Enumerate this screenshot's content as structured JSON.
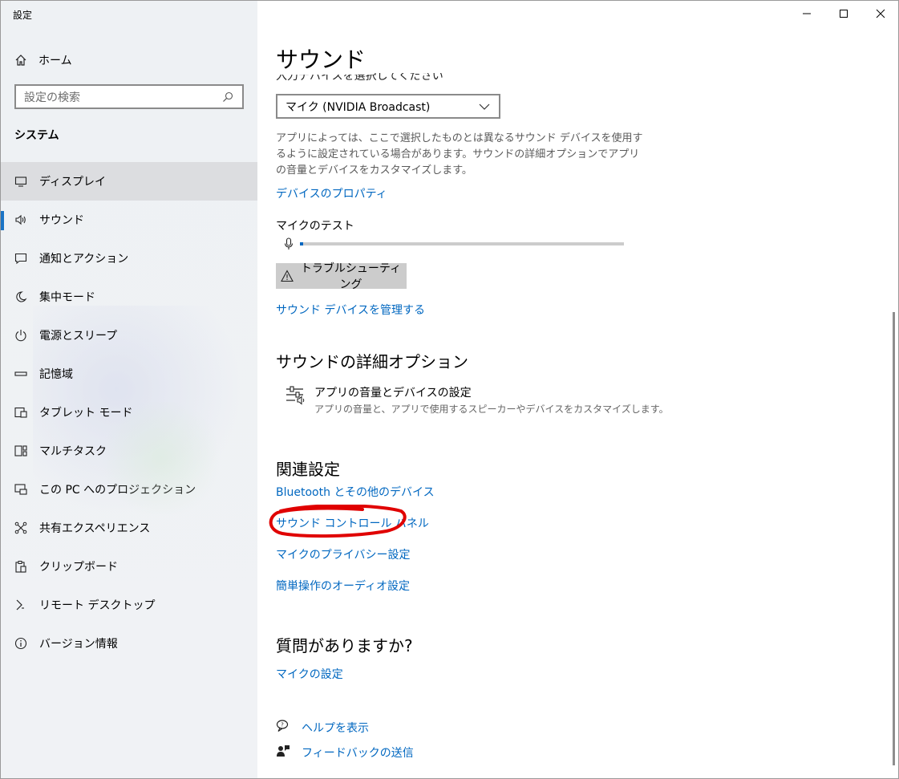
{
  "window": {
    "title": "設定",
    "controls": [
      "minimize",
      "maximize",
      "close"
    ]
  },
  "sidebar": {
    "home_label": "ホーム",
    "search_placeholder": "設定の検索",
    "section_title": "システム",
    "items": [
      {
        "label": "ディスプレイ",
        "icon": "display-icon"
      },
      {
        "label": "サウンド",
        "icon": "speaker-icon"
      },
      {
        "label": "通知とアクション",
        "icon": "notification-icon"
      },
      {
        "label": "集中モード",
        "icon": "moon-icon"
      },
      {
        "label": "電源とスリープ",
        "icon": "power-icon"
      },
      {
        "label": "記憶域",
        "icon": "storage-icon"
      },
      {
        "label": "タブレット モード",
        "icon": "tablet-icon"
      },
      {
        "label": "マルチタスク",
        "icon": "multitask-icon"
      },
      {
        "label": "この PC へのプロジェクション",
        "icon": "projection-icon"
      },
      {
        "label": "共有エクスペリエンス",
        "icon": "share-icon"
      },
      {
        "label": "クリップボード",
        "icon": "clipboard-icon"
      },
      {
        "label": "リモート デスクトップ",
        "icon": "remote-icon"
      },
      {
        "label": "バージョン情報",
        "icon": "info-icon"
      }
    ]
  },
  "main": {
    "title": "サウンド",
    "input_label_clipped": "入力デバイスを選択してください",
    "input_device": "マイク (NVIDIA Broadcast)",
    "description": "アプリによっては、ここで選択したものとは異なるサウンド デバイスを使用するように設定されている場合があります。サウンドの詳細オプションでアプリの音量とデバイスをカスタマイズします。",
    "device_properties_link": "デバイスのプロパティ",
    "mic_test_label": "マイクのテスト",
    "mic_level": 0.01,
    "troubleshoot_button": "トラブルシューティング",
    "manage_devices_link": "サウンド デバイスを管理する",
    "advanced_heading": "サウンドの詳細オプション",
    "advanced_item": {
      "title": "アプリの音量とデバイスの設定",
      "subtitle": "アプリの音量と、アプリで使用するスピーカーやデバイスをカスタマイズします。"
    },
    "related_heading": "関連設定",
    "related_links": [
      "Bluetooth とその他のデバイス",
      "サウンド コントロール パネル",
      "マイクのプライバシー設定",
      "簡単操作のオーディオ設定"
    ],
    "question_heading": "質問がありますか?",
    "mic_settings_link": "マイクの設定",
    "help_link": "ヘルプを表示",
    "feedback_link": "フィードバックの送信"
  },
  "colors": {
    "accent": "#0067c0",
    "highlight_ring": "#e00000"
  }
}
